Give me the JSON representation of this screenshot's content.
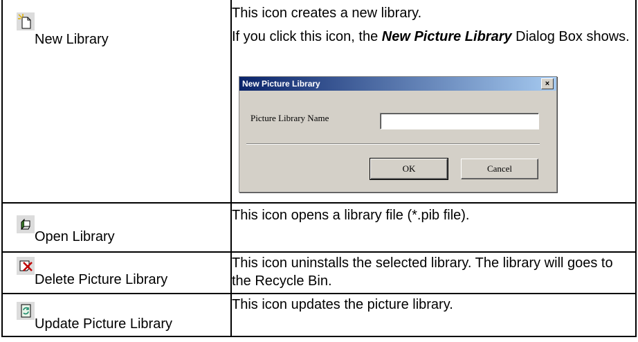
{
  "rows": [
    {
      "icon": "new-library-icon",
      "label": "New Library",
      "desc1": "This icon creates a new library.",
      "desc2_prefix": "If you click this icon, the ",
      "desc2_bold": "New Picture Library",
      "desc2_suffix": " Dialog Box shows."
    },
    {
      "icon": "open-library-icon",
      "label": "Open Library",
      "desc": "This icon opens a library file (*.pib file)."
    },
    {
      "icon": "delete-library-icon",
      "label": "Delete Picture Library",
      "desc": "This icon uninstalls the selected library. The library will goes to the Recycle Bin."
    },
    {
      "icon": "update-library-icon",
      "label": "Update Picture Library",
      "desc": "This icon updates the picture library."
    }
  ],
  "dialog": {
    "title": "New Picture Library",
    "close": "×",
    "field_label": "Picture Library Name",
    "field_value": "",
    "ok": "OK",
    "cancel": "Cancel"
  }
}
